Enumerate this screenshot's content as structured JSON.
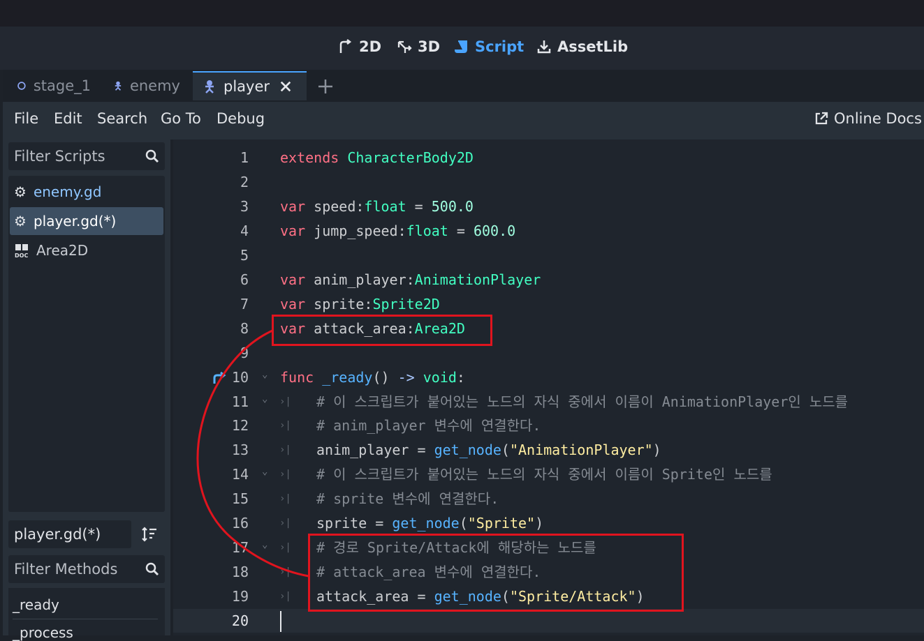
{
  "main_modes": [
    {
      "label": "2D",
      "icon": "2d-icon"
    },
    {
      "label": "3D",
      "icon": "3d-icon"
    },
    {
      "label": "Script",
      "icon": "script-icon",
      "active": true
    },
    {
      "label": "AssetLib",
      "icon": "download-icon"
    }
  ],
  "scene_tabs": [
    {
      "label": "stage_1",
      "icon": "circle-node-icon"
    },
    {
      "label": "enemy",
      "icon": "character-icon"
    },
    {
      "label": "player",
      "icon": "character-icon",
      "active": true
    }
  ],
  "menu": [
    "File",
    "Edit",
    "Search",
    "Go To",
    "Debug"
  ],
  "online_docs": "Online Docs",
  "filter_scripts_placeholder": "Filter Scripts",
  "script_list": [
    {
      "label": "enemy.gd",
      "icon": "gear-icon"
    },
    {
      "label": "player.gd(*)",
      "icon": "gear-icon",
      "selected": true
    },
    {
      "label": "Area2D",
      "icon": "doc-icon"
    }
  ],
  "current_script": "player.gd(*)",
  "filter_methods_placeholder": "Filter Methods",
  "methods": [
    "_ready",
    "_process"
  ],
  "code_lines": [
    {
      "n": "1",
      "tokens": [
        [
          "kw",
          "extends"
        ],
        [
          "id",
          " "
        ],
        [
          "ty",
          "CharacterBody2D"
        ]
      ]
    },
    {
      "n": "2",
      "tokens": []
    },
    {
      "n": "3",
      "tokens": [
        [
          "kw",
          "var"
        ],
        [
          "id",
          " speed:"
        ],
        [
          "ty",
          "float"
        ],
        [
          "id",
          " = "
        ],
        [
          "num",
          "500.0"
        ]
      ]
    },
    {
      "n": "4",
      "tokens": [
        [
          "kw",
          "var"
        ],
        [
          "id",
          " jump_speed:"
        ],
        [
          "ty",
          "float"
        ],
        [
          "id",
          " = "
        ],
        [
          "num",
          "600.0"
        ]
      ]
    },
    {
      "n": "5",
      "tokens": []
    },
    {
      "n": "6",
      "tokens": [
        [
          "kw",
          "var"
        ],
        [
          "id",
          " anim_player:"
        ],
        [
          "ty",
          "AnimationPlayer"
        ]
      ]
    },
    {
      "n": "7",
      "tokens": [
        [
          "kw",
          "var"
        ],
        [
          "id",
          " sprite:"
        ],
        [
          "ty",
          "Sprite2D"
        ]
      ]
    },
    {
      "n": "8",
      "tokens": [
        [
          "kw",
          "var"
        ],
        [
          "id",
          " attack_area:"
        ],
        [
          "ty",
          "Area2D"
        ]
      ]
    },
    {
      "n": "9",
      "tokens": []
    },
    {
      "n": "10",
      "tokens": [
        [
          "kw",
          "func"
        ],
        [
          "id",
          " "
        ],
        [
          "fn",
          "_ready"
        ],
        [
          "id",
          "() "
        ],
        [
          "op",
          "->"
        ],
        [
          "id",
          " "
        ],
        [
          "ty",
          "void"
        ],
        [
          "id",
          ":"
        ]
      ]
    },
    {
      "n": "11",
      "indent": true,
      "tokens": [
        [
          "cm",
          "# 이 스크립트가 붙어있는 노드의 자식 중에서 이름이 AnimationPlayer인 노드를"
        ]
      ]
    },
    {
      "n": "12",
      "indent": true,
      "tokens": [
        [
          "cm",
          "# anim_player 변수에 연결한다."
        ]
      ]
    },
    {
      "n": "13",
      "indent": true,
      "tokens": [
        [
          "id",
          "anim_player = "
        ],
        [
          "fn",
          "get_node"
        ],
        [
          "id",
          "("
        ],
        [
          "str",
          "\"AnimationPlayer\""
        ],
        [
          "id",
          ")"
        ]
      ]
    },
    {
      "n": "14",
      "indent": true,
      "tokens": [
        [
          "cm",
          "# 이 스크립트가 붙어있는 노드의 자식 중에서 이름이 Sprite인 노드를"
        ]
      ]
    },
    {
      "n": "15",
      "indent": true,
      "tokens": [
        [
          "cm",
          "# sprite 변수에 연결한다."
        ]
      ]
    },
    {
      "n": "16",
      "indent": true,
      "tokens": [
        [
          "id",
          "sprite = "
        ],
        [
          "fn",
          "get_node"
        ],
        [
          "id",
          "("
        ],
        [
          "str",
          "\"Sprite\""
        ],
        [
          "id",
          ")"
        ]
      ]
    },
    {
      "n": "17",
      "indent": true,
      "tokens": [
        [
          "cm",
          "# 경로 Sprite/Attack에 해당하는 노드를"
        ]
      ]
    },
    {
      "n": "18",
      "indent": true,
      "tokens": [
        [
          "cm",
          "# attack_area 변수에 연결한다."
        ]
      ]
    },
    {
      "n": "19",
      "indent": true,
      "tokens": [
        [
          "id",
          "attack_area = "
        ],
        [
          "fn",
          "get_node"
        ],
        [
          "id",
          "("
        ],
        [
          "str",
          "\"Sprite/Attack\""
        ],
        [
          "id",
          ")"
        ]
      ]
    },
    {
      "n": "20",
      "tokens": []
    }
  ],
  "colors": {
    "accent": "#4aa4ff",
    "annotation": "#e0141e"
  }
}
